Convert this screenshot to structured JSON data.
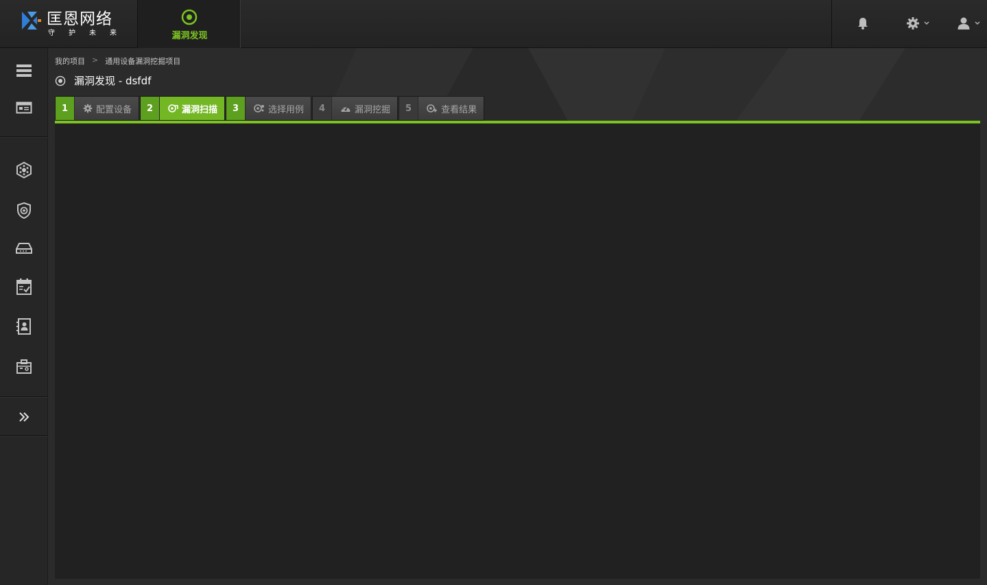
{
  "brand": {
    "name": "匡恩网络",
    "slogan": "守护未来"
  },
  "top_nav": {
    "active_tab": "漏洞发现"
  },
  "breadcrumb": {
    "items": [
      "我的项目",
      "通用设备漏洞挖掘项目"
    ],
    "separator": ">"
  },
  "page": {
    "title": "漏洞发现 - dsfdf"
  },
  "steps": [
    {
      "num": "1",
      "label": "配置设备",
      "state": "done",
      "icon": "gear-icon"
    },
    {
      "num": "2",
      "label": "漏洞扫描",
      "state": "active",
      "icon": "scan-icon"
    },
    {
      "num": "3",
      "label": "选择用例",
      "state": "done",
      "icon": "testcase-icon"
    },
    {
      "num": "4",
      "label": "漏洞挖掘",
      "state": "pending",
      "icon": "gauge-icon"
    },
    {
      "num": "5",
      "label": "查看结果",
      "state": "pending",
      "icon": "result-icon"
    }
  ],
  "colors": {
    "accent": "#7cc322",
    "accent_dark": "#5d9f1e",
    "brand_blue": "#2f7fd8",
    "brand_orange": "#e8862a"
  }
}
